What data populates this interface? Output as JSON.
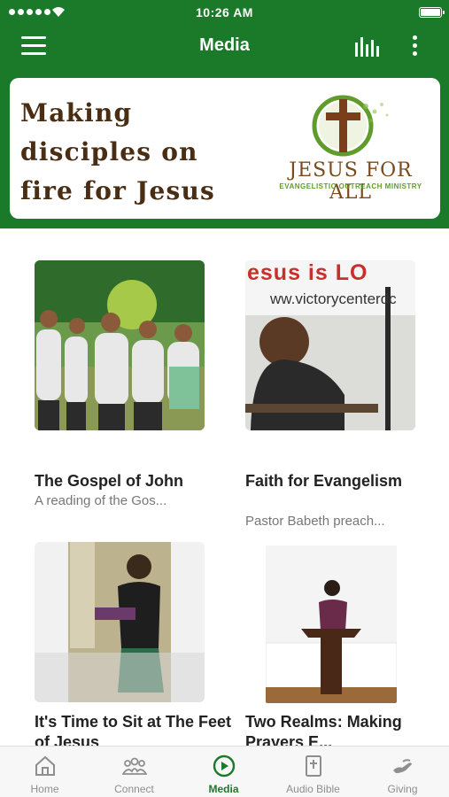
{
  "status_bar": {
    "time": "10:26 AM"
  },
  "nav": {
    "title": "Media",
    "menu_icon": "hamburger-menu-icon",
    "stats_icon": "bars-icon",
    "more_icon": "more-vertical-icon"
  },
  "banner": {
    "tagline": "Making disciples on fire for Jesus",
    "logo_title": "JESUS FOR ALL",
    "logo_subtitle": "EVANGELISTIC OUTREACH MINISTRY"
  },
  "media": [
    {
      "title": "The Gospel of John",
      "subtitle": "A reading of the Gos..."
    },
    {
      "title": "Faith for Evangelism",
      "subtitle": "Pastor Babeth preach...",
      "thumb_sign_text": "esus is LO",
      "thumb_sign_url": "ww.victorycenterdc"
    },
    {
      "title": "It's Time to Sit at The Feet of Jesus",
      "subtitle": ""
    },
    {
      "title": "Two Realms: Making Prayers E...",
      "subtitle": ""
    }
  ],
  "tabs": [
    {
      "label": "Home",
      "icon": "home-icon"
    },
    {
      "label": "Connect",
      "icon": "people-icon"
    },
    {
      "label": "Media",
      "icon": "play-circle-icon",
      "active": true
    },
    {
      "label": "Audio Bible",
      "icon": "bible-icon"
    },
    {
      "label": "Giving",
      "icon": "giving-hand-icon"
    }
  ],
  "colors": {
    "brand_green": "#1b7a2a",
    "tagline_brown": "#4a2e14",
    "tab_inactive": "#8e8e8e"
  }
}
